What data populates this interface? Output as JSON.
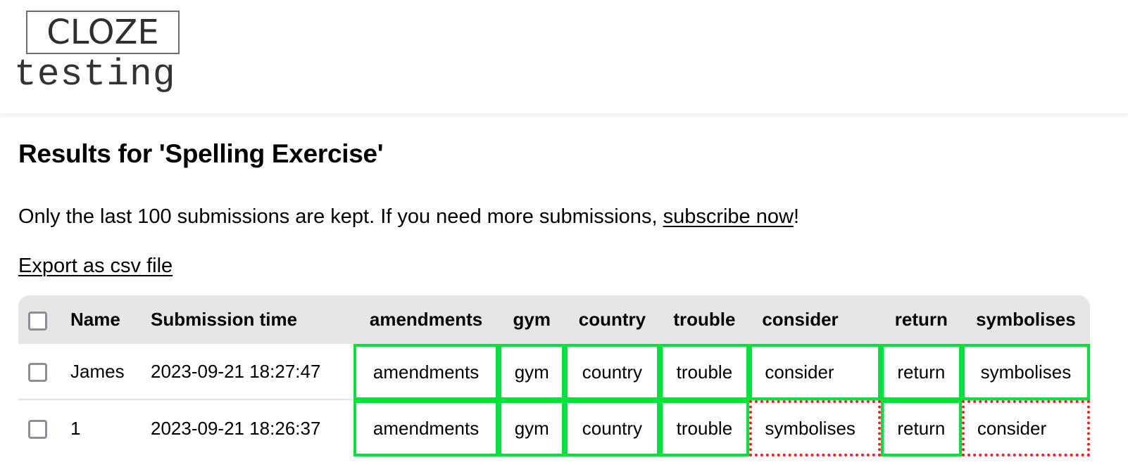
{
  "logo": {
    "top_text": "CLOZE",
    "bottom_text": "testing"
  },
  "page": {
    "title": "Results for 'Spelling Exercise'",
    "notice_prefix": "Only the last 100 submissions are kept. If you need more submissions, ",
    "notice_link": "subscribe now",
    "notice_suffix": "!",
    "export_link": "Export as csv file"
  },
  "table": {
    "headers": {
      "name": "Name",
      "time": "Submission time",
      "answers": [
        "amendments",
        "gym",
        "country",
        "trouble",
        "consider",
        "return",
        "symbolises"
      ]
    },
    "rows": [
      {
        "name": "James",
        "time": "2023-09-21 18:27:47",
        "answers": [
          {
            "value": "amendments",
            "status": "correct"
          },
          {
            "value": "gym",
            "status": "correct"
          },
          {
            "value": "country",
            "status": "correct"
          },
          {
            "value": "trouble",
            "status": "correct"
          },
          {
            "value": "consider",
            "status": "correct"
          },
          {
            "value": "return",
            "status": "correct"
          },
          {
            "value": "symbolises",
            "status": "correct"
          }
        ]
      },
      {
        "name": "1",
        "time": "2023-09-21 18:26:37",
        "answers": [
          {
            "value": "amendments",
            "status": "correct"
          },
          {
            "value": "gym",
            "status": "correct"
          },
          {
            "value": "country",
            "status": "correct"
          },
          {
            "value": "trouble",
            "status": "correct"
          },
          {
            "value": "symbolises",
            "status": "wrong"
          },
          {
            "value": "return",
            "status": "correct"
          },
          {
            "value": "consider",
            "status": "wrong"
          }
        ]
      }
    ]
  },
  "colors": {
    "correct_border": "#00e33a",
    "wrong_border": "#ff1a1a",
    "header_bg": "#e6e6e6"
  }
}
